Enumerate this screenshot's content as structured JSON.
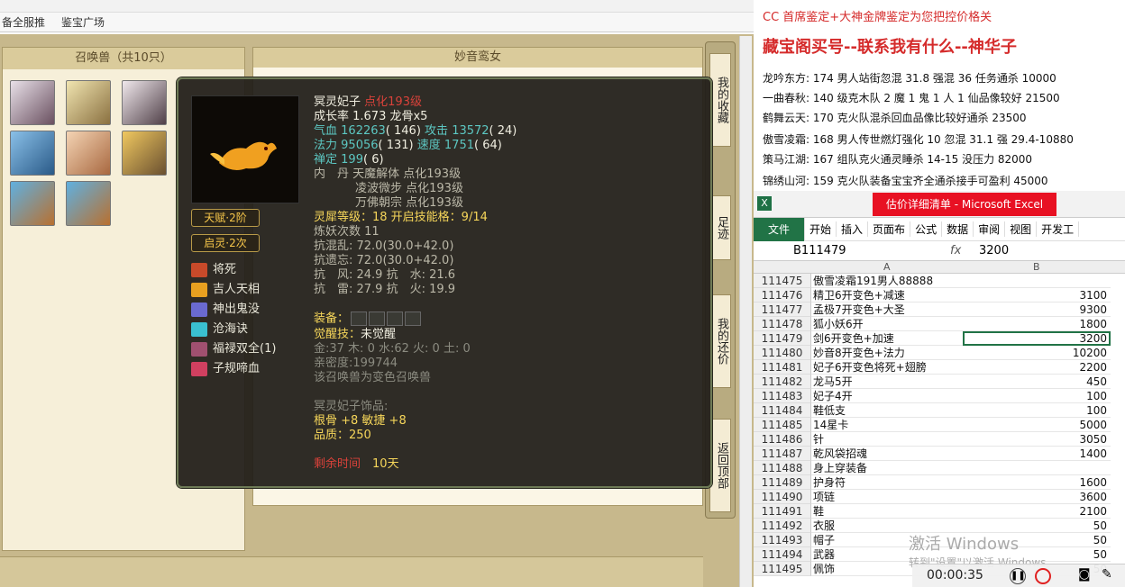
{
  "browser": {
    "bookmarks": [
      "备全服推",
      "鉴宝广场"
    ]
  },
  "game": {
    "left_panel_title": "召唤兽（共10只）",
    "right_panel_title": "妙音鸾女",
    "side_buttons": [
      "我的收藏",
      "足迹",
      "我的还价",
      "返回顶部"
    ],
    "tooltip": {
      "name": "冥灵妃子",
      "name_suffix": "点化193级",
      "growth": "成长率 1.673 龙骨x5",
      "hp_label": "气血",
      "hp": "162263",
      "hp_rank": "( 146)",
      "atk_label": "攻击",
      "atk": "13572",
      "atk_rank": "( 24)",
      "mp_label": "法力",
      "mp": "95056",
      "mp_rank": "( 131)",
      "spd_label": "速度",
      "spd": "1751",
      "spd_rank": "( 64)",
      "ding_label": "禅定",
      "ding": "199",
      "ding_rank": "( 6)",
      "neidan": [
        "内　丹 天魔解体 点化193级",
        "凌波微步 点化193级",
        "万佛朝宗 点化193级"
      ],
      "lingxi": "灵犀等级：18 开启技能格：9/14",
      "lianyao": "炼妖次数 11",
      "kanghun": "抗混乱: 72.0(30.0+42.0)",
      "kangyi": "抗遗忘: 72.0(30.0+42.0)",
      "kangfeng": "抗　风: 24.9 抗　水: 21.6",
      "kanglei": "抗　雷: 27.9 抗　火: 19.9",
      "equip_label": "装备：",
      "awaken_label": "觉醒技：",
      "awaken": "未觉醒",
      "elements": "金:37 木: 0 水:62 火: 0 土: 0",
      "intimacy": "亲密度:199744",
      "variant": "该召唤兽为变色召唤兽",
      "accessory_title": "冥灵妃子饰品:",
      "accessory_stats": "根骨 +8 敏捷 +8",
      "accessory_quality": "品质：250",
      "days_label": "剩余时间",
      "days": "10天",
      "badges": [
        "天赋·2阶",
        "启灵·2次"
      ],
      "skills": [
        "将死",
        "吉人天相",
        "神出鬼没",
        "沧海诀",
        "福禄双全(1)",
        "子规啼血"
      ]
    }
  },
  "notes": {
    "header1": "CC 首席鉴定+大神金牌鉴定为您把控价格关",
    "header2": "藏宝阁买号--联系我有什么--神华子",
    "lines": [
      "龙吟东方: 174 男人站街忽混 31.8 强混 36 任务通杀 10000",
      "一曲春秋: 140 级克木队 2 魔 1 鬼 1 人 1 仙品像较好 21500",
      "鹤舞云天: 170 克火队混杀回血品像比较好通杀 23500",
      "傲雪凌霜: 168 男人传世燃灯强化 10 忽混 31.1 强 29.4-10880",
      "策马江湖: 167 组队克火通灵睡杀 14-15 没压力 82000",
      "锦绣山河: 159 克火队装备宝宝齐全通杀接手可盈利 45000"
    ]
  },
  "excel": {
    "title": "估价详细清单 - Microsoft Excel",
    "ribbon": [
      "文件",
      "开始",
      "插入",
      "页面布",
      "公式",
      "数据",
      "审阅",
      "视图",
      "开发工"
    ],
    "name_box": "B111479",
    "fx": "fx",
    "formula": "3200",
    "col_a": "A",
    "col_b": "B",
    "rows": [
      {
        "n": "111475",
        "a": "傲雪凌霜191男人88888",
        "b": ""
      },
      {
        "n": "111476",
        "a": "精卫6开变色+减速",
        "b": "3100"
      },
      {
        "n": "111477",
        "a": "孟极7开变色+大圣",
        "b": "9300"
      },
      {
        "n": "111478",
        "a": "狐小妖6开",
        "b": "1800"
      },
      {
        "n": "111479",
        "a": "剑6开变色+加速",
        "b": "3200"
      },
      {
        "n": "111480",
        "a": "妙音8开变色+法力",
        "b": "10200"
      },
      {
        "n": "111481",
        "a": "妃子6开变色将死+翅膀",
        "b": "2200"
      },
      {
        "n": "111482",
        "a": "龙马5开",
        "b": "450"
      },
      {
        "n": "111483",
        "a": "妃子4开",
        "b": "100"
      },
      {
        "n": "111484",
        "a": "鞋低支",
        "b": "100"
      },
      {
        "n": "111485",
        "a": "14星卡",
        "b": "5000"
      },
      {
        "n": "111486",
        "a": "针",
        "b": "3050"
      },
      {
        "n": "111487",
        "a": "乾风袋招魂",
        "b": "1400"
      },
      {
        "n": "111488",
        "a": "身上穿装备",
        "b": ""
      },
      {
        "n": "111489",
        "a": "护身符",
        "b": "1600"
      },
      {
        "n": "111490",
        "a": "项链",
        "b": "3600"
      },
      {
        "n": "111491",
        "a": "鞋",
        "b": "2100"
      },
      {
        "n": "111492",
        "a": "衣服",
        "b": "50"
      },
      {
        "n": "111493",
        "a": "帽子",
        "b": "50"
      },
      {
        "n": "111494",
        "a": "武器",
        "b": "50"
      },
      {
        "n": "111495",
        "a": "佩饰",
        "b": "50"
      }
    ]
  },
  "overlay": {
    "activate": "激活 Windows",
    "activate_sub": "转到\"设置\"以激活 Windows。",
    "timer": "00:00:35"
  }
}
